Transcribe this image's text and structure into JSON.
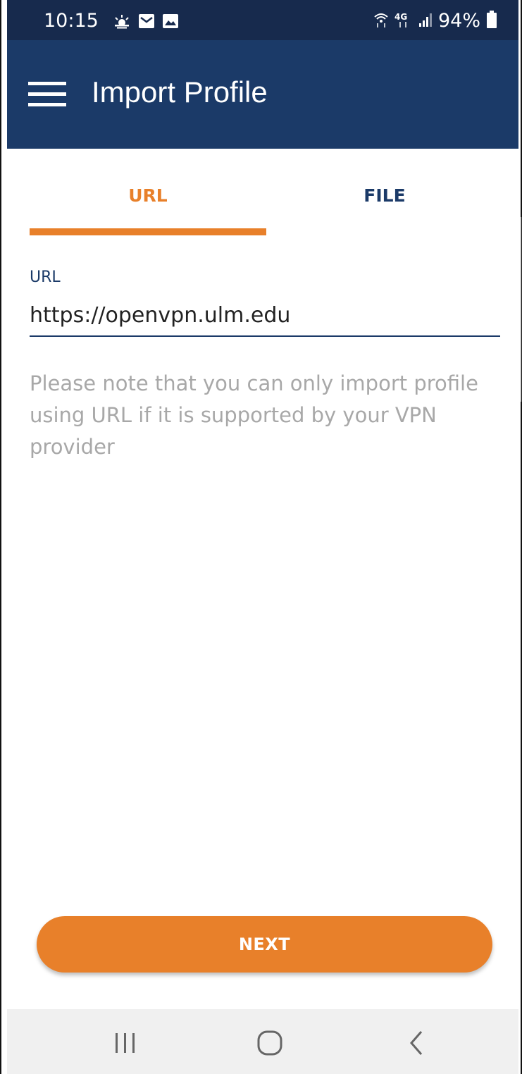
{
  "status_bar": {
    "time": "10:15",
    "battery_percent": "94%",
    "left_icons": [
      "weather-icon",
      "mail-icon",
      "image-icon"
    ],
    "right_icons": [
      "wifi-icon",
      "lte-icon",
      "signal-icon",
      "battery-icon"
    ],
    "network_label": "4G"
  },
  "app_bar": {
    "title": "Import Profile"
  },
  "tabs": [
    {
      "label": "URL",
      "selected": true
    },
    {
      "label": "FILE",
      "selected": false
    }
  ],
  "url_field": {
    "label": "URL",
    "value": "https://openvpn.ulm.edu"
  },
  "note": "Please note that you can only import profile using URL if it is supported by your VPN provider",
  "next_button": {
    "label": "NEXT"
  },
  "colors": {
    "app_bar": "#1b3a68",
    "status_bar": "#172a4d",
    "accent": "#e8802a",
    "note_text": "#a8a8a8",
    "nav_bar": "#f0f0f0"
  }
}
